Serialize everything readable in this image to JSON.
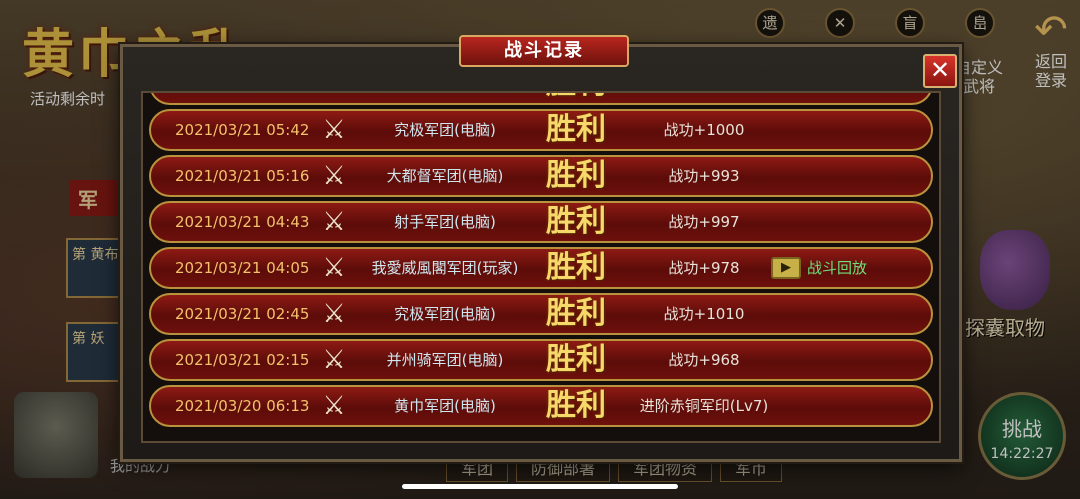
{
  "background": {
    "event_title": "黄巾之乱",
    "event_remaining": "活动剩余时",
    "left_banner": "军",
    "left_cards": [
      "第\n黄布",
      "第\n妖"
    ],
    "bottom_strip": "我的战力",
    "top_icons": [
      "遗",
      "✕",
      "盲",
      "峊"
    ],
    "custom_general": "自定义\n武将",
    "back_label": "返回\n登录",
    "pouch_label": "探囊取物",
    "challenge_label": "挑战",
    "challenge_timer": "14:22:27",
    "bottom_tabs": [
      "军团",
      "防御部署",
      "军团物资",
      "军币"
    ]
  },
  "modal": {
    "title": "战斗记录",
    "close_icon": "close-icon",
    "records": [
      {
        "time": "2021/03/21 05:42",
        "opponent": "究极军团(电脑)",
        "result": "胜利",
        "reward": "战功+1000",
        "replay": ""
      },
      {
        "time": "2021/03/21 05:16",
        "opponent": "大都督军团(电脑)",
        "result": "胜利",
        "reward": "战功+993",
        "replay": ""
      },
      {
        "time": "2021/03/21 04:43",
        "opponent": "射手军团(电脑)",
        "result": "胜利",
        "reward": "战功+997",
        "replay": ""
      },
      {
        "time": "2021/03/21 04:05",
        "opponent": "我愛威風閣军团(玩家)",
        "result": "胜利",
        "reward": "战功+978",
        "replay": "战斗回放"
      },
      {
        "time": "2021/03/21 02:45",
        "opponent": "究极军团(电脑)",
        "result": "胜利",
        "reward": "战功+1010",
        "replay": ""
      },
      {
        "time": "2021/03/21 02:15",
        "opponent": "并州骑军团(电脑)",
        "result": "胜利",
        "reward": "战功+968",
        "replay": ""
      },
      {
        "time": "2021/03/20 06:13",
        "opponent": "黄巾军团(电脑)",
        "result": "胜利",
        "reward": "进阶赤铜军印(Lv7)",
        "replay": ""
      }
    ],
    "partial_top_row": {
      "result": "胜利"
    }
  },
  "colors": {
    "row_red": "#8e1a14",
    "row_border": "#b8923c",
    "time_text": "#f3c26a",
    "opponent_text": "#cfe6ee",
    "result_gold": "#f7d86a",
    "replay_green": "#6fe07a"
  }
}
